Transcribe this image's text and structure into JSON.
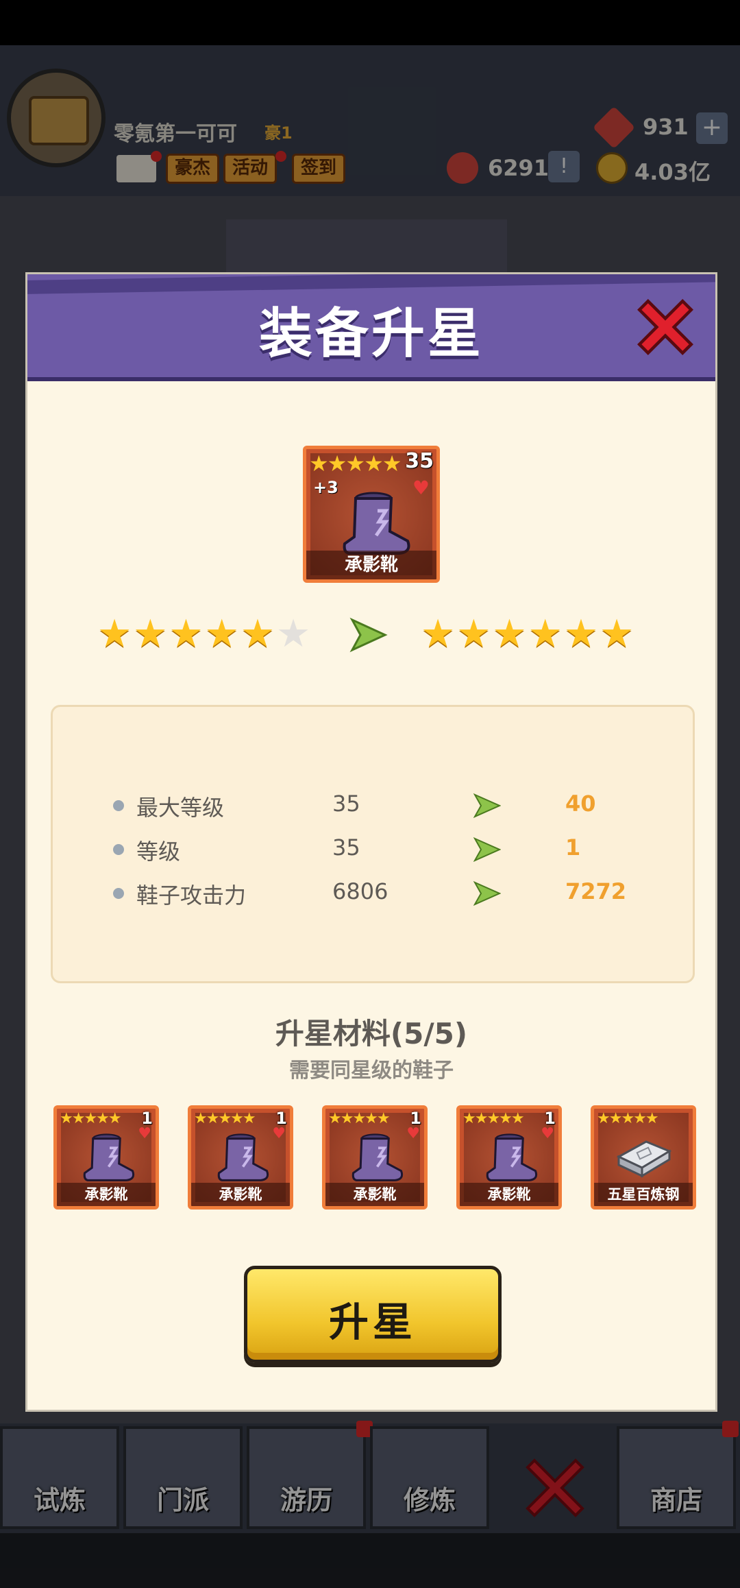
{
  "hud": {
    "player_name": "零氪第一可可",
    "player_level": "豪1",
    "tags": [
      "豪杰",
      "活动",
      "签到"
    ],
    "gems": "931",
    "gems_plus": "+",
    "tokens": "6291",
    "tokens_alert": "!",
    "coins": "4.03亿"
  },
  "nav": {
    "tabs": [
      "试炼",
      "门派",
      "游历",
      "修炼",
      "商店"
    ]
  },
  "dialog": {
    "title": "装备升星",
    "item": {
      "name": "承影靴",
      "stars": "★★★★★",
      "level": "35",
      "enhance": "+3"
    },
    "stars_before_filled": 5,
    "stars_before_total": 6,
    "stars_after_filled": 6,
    "stats": [
      {
        "name": "最大等级",
        "from": "35",
        "to": "40"
      },
      {
        "name": "等级",
        "from": "35",
        "to": "1"
      },
      {
        "name": "鞋子攻击力",
        "from": "6806",
        "to": "7272"
      }
    ],
    "materials_title": "升星材料(5/5)",
    "materials_subtitle": "需要同星级的鞋子",
    "materials": [
      {
        "name": "承影靴",
        "stars": "★★★★★",
        "level": "1",
        "type": "boot"
      },
      {
        "name": "承影靴",
        "stars": "★★★★★",
        "level": "1",
        "type": "boot"
      },
      {
        "name": "承影靴",
        "stars": "★★★★★",
        "level": "1",
        "type": "boot"
      },
      {
        "name": "承影靴",
        "stars": "★★★★★",
        "level": "1",
        "type": "boot"
      },
      {
        "name": "五星百炼钢",
        "stars": "★★★★★",
        "level": "",
        "type": "steel"
      }
    ],
    "button_label": "升星"
  },
  "colors": {
    "header_purple": "#6d5aa6",
    "dialog_bg": "#fdf6e4",
    "stat_highlight": "#f0a02e",
    "star_gold": "#ffc21f",
    "button_yellow": "#f1c52c",
    "card_orange": "#c6512c"
  }
}
